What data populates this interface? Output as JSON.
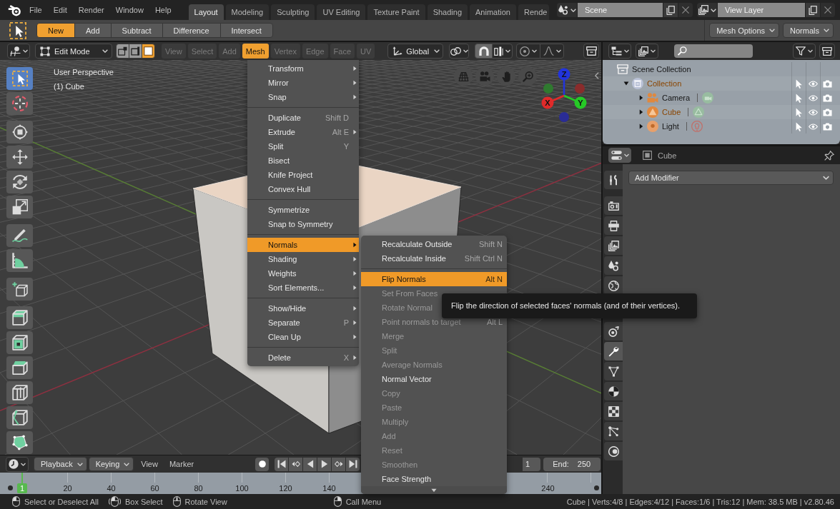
{
  "top_bar": {
    "menus": [
      "File",
      "Edit",
      "Render",
      "Window",
      "Help"
    ],
    "workspaces": [
      {
        "label": "Layout",
        "selected": true
      },
      {
        "label": "Modeling",
        "selected": false
      },
      {
        "label": "Sculpting",
        "selected": false
      },
      {
        "label": "UV Editing",
        "selected": false
      },
      {
        "label": "Texture Paint",
        "selected": false
      },
      {
        "label": "Shading",
        "selected": false
      },
      {
        "label": "Animation",
        "selected": false
      },
      {
        "label": "Rende",
        "selected": false
      }
    ],
    "scene": "Scene",
    "view_layer": "View Layer"
  },
  "tool_settings": {
    "modes": [
      {
        "label": "New",
        "selected": true
      },
      {
        "label": "Add",
        "selected": false
      },
      {
        "label": "Subtract",
        "selected": false
      },
      {
        "label": "Difference",
        "selected": false
      },
      {
        "label": "Intersect",
        "selected": false
      }
    ],
    "dropdowns": [
      "Mesh Options",
      "Normals"
    ]
  },
  "viewport": {
    "header": {
      "mode": "Edit Mode",
      "select_modes": [
        {
          "kind": "vertex",
          "selected": false
        },
        {
          "kind": "edge",
          "selected": false
        },
        {
          "kind": "face",
          "selected": true
        }
      ],
      "menus": [
        {
          "label": "View",
          "selected": false
        },
        {
          "label": "Select",
          "selected": false
        },
        {
          "label": "Add",
          "selected": false
        },
        {
          "label": "Mesh",
          "selected": true
        },
        {
          "label": "Vertex",
          "selected": false
        },
        {
          "label": "Edge",
          "selected": false
        },
        {
          "label": "Face",
          "selected": false
        },
        {
          "label": "UV",
          "selected": false
        }
      ],
      "orientation": "Global",
      "snap": {
        "on": true
      },
      "proportional_editing": {
        "on": false
      }
    },
    "overlay_text": [
      "User Perspective",
      "(1) Cube"
    ],
    "tool_groups": [
      [
        {
          "kind": "select_box",
          "selected": true
        },
        {
          "kind": "cursor",
          "selected": false
        }
      ],
      [
        {
          "kind": "transform",
          "selected": false
        },
        {
          "kind": "move",
          "selected": false
        },
        {
          "kind": "rotate",
          "selected": false
        },
        {
          "kind": "scale",
          "selected": false
        }
      ],
      [
        {
          "kind": "annotate",
          "selected": false
        },
        {
          "kind": "measure",
          "selected": false
        }
      ],
      [
        {
          "kind": "add_cube",
          "selected": false
        }
      ],
      [
        {
          "kind": "extrude",
          "selected": false
        },
        {
          "kind": "inset",
          "selected": false
        },
        {
          "kind": "bevel",
          "selected": false
        },
        {
          "kind": "loop_cut",
          "selected": false
        },
        {
          "kind": "knife",
          "selected": false
        },
        {
          "kind": "poly_build",
          "selected": false
        }
      ]
    ],
    "gizmo_axes": [
      {
        "kind": "positive",
        "label": "Z",
        "color": "#2234dc"
      },
      {
        "kind": "negative",
        "color": "#2f7a2f"
      },
      {
        "kind": "negative",
        "color": "#8a2c2c"
      },
      {
        "kind": "positive",
        "label": "X",
        "color": "#e02a2a"
      },
      {
        "kind": "positive",
        "label": "Y",
        "color": "#26c926"
      },
      {
        "kind": "negative",
        "color": "#2a2c96"
      }
    ]
  },
  "mesh_menu": {
    "groups": [
      [
        {
          "label": "Transform",
          "submenu": true,
          "selected": false
        },
        {
          "label": "Mirror",
          "submenu": true,
          "selected": false
        },
        {
          "label": "Snap",
          "submenu": true,
          "selected": false
        }
      ],
      [
        {
          "label": "Duplicate",
          "shortcut": "Shift D",
          "submenu": false,
          "selected": false
        },
        {
          "label": "Extrude",
          "shortcut": "Alt E",
          "submenu": true,
          "selected": false
        },
        {
          "label": "Split",
          "shortcut": "Y",
          "submenu": false,
          "selected": false
        },
        {
          "label": "Bisect",
          "submenu": false,
          "selected": false
        },
        {
          "label": "Knife Project",
          "submenu": false,
          "selected": false
        },
        {
          "label": "Convex Hull",
          "submenu": false,
          "selected": false
        }
      ],
      [
        {
          "label": "Symmetrize",
          "submenu": false,
          "selected": false
        },
        {
          "label": "Snap to Symmetry",
          "submenu": false,
          "selected": false
        }
      ],
      [
        {
          "label": "Normals",
          "submenu": true,
          "selected": true
        },
        {
          "label": "Shading",
          "submenu": true,
          "selected": false
        },
        {
          "label": "Weights",
          "submenu": true,
          "selected": false
        },
        {
          "label": "Sort Elements...",
          "submenu": true,
          "selected": false
        }
      ],
      [
        {
          "label": "Show/Hide",
          "submenu": true,
          "selected": false
        },
        {
          "label": "Separate",
          "shortcut": "P",
          "submenu": true,
          "selected": false
        },
        {
          "label": "Clean Up",
          "submenu": true,
          "selected": false
        }
      ],
      [
        {
          "label": "Delete",
          "shortcut": "X",
          "submenu": true,
          "selected": false
        }
      ]
    ]
  },
  "normals_submenu": {
    "groups": [
      [
        {
          "label": "Recalculate Outside",
          "shortcut": "Shift N",
          "selected": false,
          "disabled": false
        },
        {
          "label": "Recalculate Inside",
          "shortcut": "Shift Ctrl N",
          "selected": false,
          "disabled": false
        }
      ],
      [
        {
          "label": "Flip Normals",
          "shortcut": "Alt N",
          "selected": true,
          "disabled": false
        },
        {
          "label": "Set From Faces",
          "selected": false,
          "disabled": true
        },
        {
          "label": "Rotate Normal",
          "selected": false,
          "disabled": true
        },
        {
          "label": "Point normals to target",
          "shortcut": "Alt L",
          "selected": false,
          "disabled": true
        },
        {
          "label": "Merge",
          "selected": false,
          "disabled": true
        },
        {
          "label": "Split",
          "selected": false,
          "disabled": true
        },
        {
          "label": "Average Normals",
          "selected": false,
          "disabled": true
        },
        {
          "label": "Normal Vector",
          "selected": false,
          "disabled": false
        },
        {
          "label": "Copy",
          "selected": false,
          "disabled": true
        },
        {
          "label": "Paste",
          "selected": false,
          "disabled": true
        },
        {
          "label": "Multiply",
          "selected": false,
          "disabled": true
        },
        {
          "label": "Add",
          "selected": false,
          "disabled": true
        },
        {
          "label": "Reset",
          "selected": false,
          "disabled": true
        },
        {
          "label": "Smoothen",
          "selected": false,
          "disabled": true
        },
        {
          "label": "Face Strength",
          "selected": false,
          "disabled": false
        }
      ]
    ],
    "scroll_down": true
  },
  "tooltip": "Flip the direction of selected faces' normals (and of their vertices).",
  "outliner": {
    "tree": [
      {
        "label": "Scene Collection",
        "kind": "scene_collection",
        "selected": false,
        "children": [
          {
            "label": "Collection",
            "kind": "collection",
            "selected": true,
            "expanded": true,
            "children": [
              {
                "label": "Camera",
                "kind": "camera",
                "selected": false,
                "expanded": false
              },
              {
                "label": "Cube",
                "kind": "mesh",
                "selected": true,
                "expanded": false
              },
              {
                "label": "Light",
                "kind": "light",
                "selected": false,
                "expanded": false
              }
            ]
          }
        ]
      }
    ]
  },
  "properties": {
    "object": "Cube",
    "tab_groups": [
      [
        {
          "kind": "tool",
          "selected": false
        }
      ],
      [
        {
          "kind": "render",
          "selected": false
        },
        {
          "kind": "output",
          "selected": false
        },
        {
          "kind": "view_layer",
          "selected": false
        },
        {
          "kind": "scene",
          "selected": false
        },
        {
          "kind": "world",
          "selected": false
        }
      ],
      [
        {
          "kind": "constraints",
          "selected": false
        },
        {
          "kind": "modifiers",
          "selected": true
        },
        {
          "kind": "data",
          "selected": false
        },
        {
          "kind": "material",
          "selected": false
        },
        {
          "kind": "texture",
          "selected": false
        },
        {
          "kind": "particles",
          "selected": false
        },
        {
          "kind": "physics",
          "selected": false
        }
      ]
    ],
    "add_modifier": "Add Modifier"
  },
  "timeline": {
    "menus": [
      {
        "label": "Playback",
        "kind": "dropdown"
      },
      {
        "label": "Keying",
        "kind": "dropdown"
      },
      {
        "label": "View",
        "kind": "menu"
      },
      {
        "label": "Marker",
        "kind": "menu"
      }
    ],
    "start": {
      "value": "1"
    },
    "end": {
      "label": "End:",
      "value": "250"
    },
    "frame_labels": [
      "20",
      "40",
      "60",
      "80",
      "100",
      "120",
      "140",
      "240"
    ],
    "current_frame": "1"
  },
  "status_bar": {
    "hints": [
      {
        "kind": "left_click",
        "label": "Select or Deselect All"
      },
      {
        "kind": "left_drag",
        "label": "Box Select"
      },
      {
        "kind": "middle_drag",
        "label": "Rotate View"
      },
      {
        "kind": "right_click",
        "label": "Call Menu"
      }
    ],
    "stats": "Cube | Verts:4/8 | Edges:4/12 | Faces:1/6 | Tris:12 | Mem: 38.5 MB | v2.80.46"
  }
}
